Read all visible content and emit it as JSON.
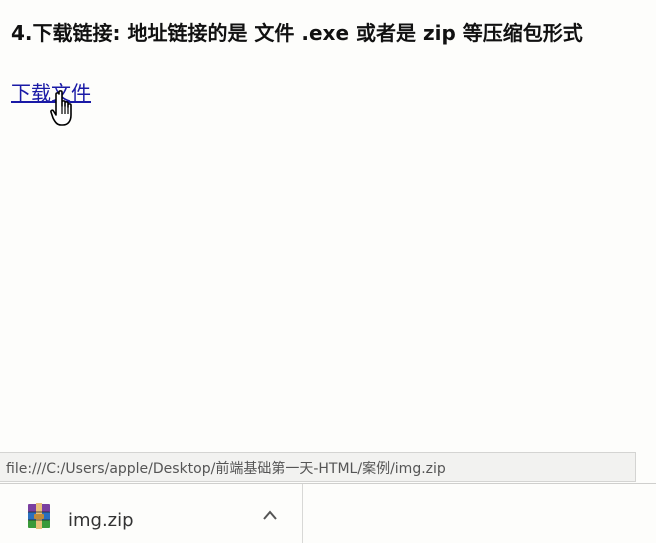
{
  "page": {
    "heading": "4.下载链接: 地址链接的是 文件 .exe 或者是 zip 等压缩包形式",
    "link_text": "下载文件"
  },
  "status_bar": {
    "url": "file:///C:/Users/apple/Desktop/前端基础第一天-HTML/案例/img.zip"
  },
  "download_bar": {
    "items": [
      {
        "file_name": "img.zip",
        "icon": "winrar-archive-icon"
      }
    ]
  },
  "colors": {
    "link": "#1a1aa6",
    "background": "#fdfdfb"
  }
}
